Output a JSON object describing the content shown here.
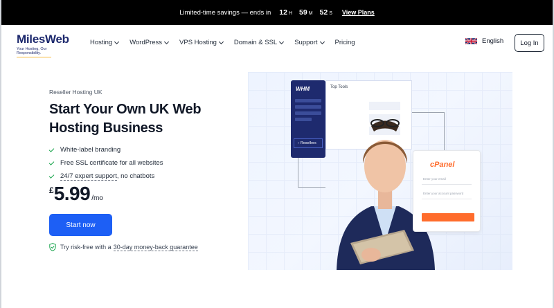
{
  "promo": {
    "text": "Limited-time savings — ends in",
    "countdown": [
      {
        "value": "12",
        "unit": "H"
      },
      {
        "value": "59",
        "unit": "M"
      },
      {
        "value": "52",
        "unit": "S"
      }
    ],
    "link": "View Plans"
  },
  "brand": {
    "name": "MilesWeb",
    "tagline": "Your Hosting, Our Responsibility."
  },
  "nav": {
    "items": [
      {
        "label": "Hosting",
        "dropdown": true
      },
      {
        "label": "WordPress",
        "dropdown": true
      },
      {
        "label": "VPS Hosting",
        "dropdown": true
      },
      {
        "label": "Domain & SSL",
        "dropdown": true
      },
      {
        "label": "Support",
        "dropdown": true
      },
      {
        "label": "Pricing",
        "dropdown": false
      }
    ],
    "language": "English",
    "login": "Log In"
  },
  "hero": {
    "eyebrow": "Reseller Hosting UK",
    "title": "Start Your Own UK Web Hosting Business",
    "features": [
      "White-label branding",
      "Free SSL certificate for all websites",
      "24/7 expert support, no chatbots"
    ],
    "feature3_underlined": "24/7 expert support",
    "feature3_rest": ", no chatbots",
    "price": {
      "currency": "£",
      "amount": "5.99",
      "period": "/mo"
    },
    "cta": "Start now",
    "guarantee_prefix": "Try risk-free with a ",
    "guarantee_link": "30-day money-back guarantee"
  },
  "illustration": {
    "whm_logo": "WHM",
    "whm_item": "Resellers",
    "tools_title": "Top Tools",
    "cpanel_logo": "cPanel",
    "cpanel_email_placeholder": "Enter your email",
    "cpanel_password_placeholder": "Enter your account password"
  },
  "colors": {
    "accent": "#1d5ff5",
    "brand_navy": "#1e2a6e",
    "check_green": "#16a34a",
    "cpanel_orange": "#ff6c2c"
  }
}
